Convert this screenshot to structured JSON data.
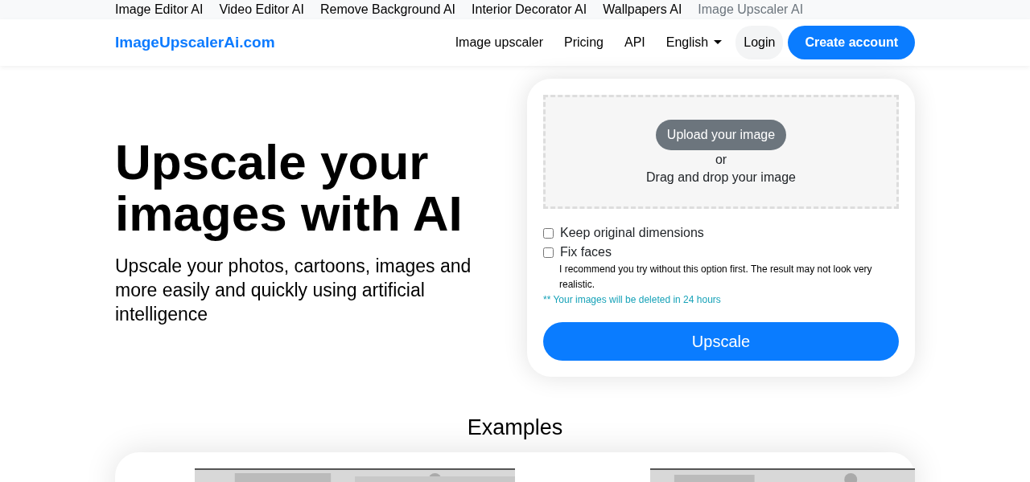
{
  "top_links": [
    {
      "label": "Image Editor AI",
      "selected": false
    },
    {
      "label": "Video Editor AI",
      "selected": false
    },
    {
      "label": "Remove Background AI",
      "selected": false
    },
    {
      "label": "Interior Decorator AI",
      "selected": false
    },
    {
      "label": "Wallpapers AI",
      "selected": false
    },
    {
      "label": "Image Upscaler AI",
      "selected": true
    }
  ],
  "navbar": {
    "brand": "ImageUpscalerAi.com",
    "links": [
      "Image upscaler",
      "Pricing",
      "API"
    ],
    "language": "English",
    "login": "Login",
    "create_account": "Create account"
  },
  "hero": {
    "title": "Upscale your images with AI",
    "subtitle": "Upscale your photos, cartoons, images and more easily and quickly using artificial intelligence"
  },
  "upload": {
    "button": "Upload your image",
    "or": "or",
    "drag": "Drag and drop your image"
  },
  "options": [
    {
      "label": "Keep original dimensions",
      "checked": false
    },
    {
      "label": "Fix faces",
      "checked": false,
      "note": "I recommend you try without this option first. The result may not look very realistic."
    }
  ],
  "notice": "** Your images will be deleted in 24 hours",
  "submit": "Upscale",
  "examples": {
    "title": "Examples"
  }
}
